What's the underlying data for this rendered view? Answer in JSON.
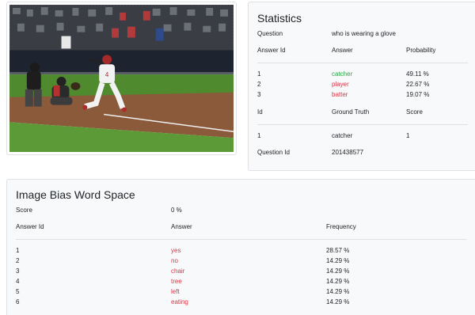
{
  "statistics": {
    "title": "Statistics",
    "question_label": "Question",
    "question_value": "who is wearing a glove",
    "headers": {
      "answer_id": "Answer Id",
      "answer": "Answer",
      "probability": "Probability"
    },
    "answers": [
      {
        "id": "1",
        "answer": "catcher",
        "probability": "49.11 %",
        "color": "#28a745"
      },
      {
        "id": "2",
        "answer": "player",
        "probability": "22.67 %",
        "color": "#dc3545"
      },
      {
        "id": "3",
        "answer": "batter",
        "probability": "19.07 %",
        "color": "#dc3545"
      }
    ],
    "gt_headers": {
      "id": "Id",
      "ground_truth": "Ground Truth",
      "score": "Score"
    },
    "ground_truth": [
      {
        "id": "1",
        "answer": "catcher",
        "score": "1"
      }
    ],
    "question_id_label": "Question Id",
    "question_id_value": "201438577"
  },
  "bias": {
    "title": "Image Bias Word Space",
    "score_label": "Score",
    "score_value": "0 %",
    "headers": {
      "answer_id": "Answer Id",
      "answer": "Answer",
      "frequency": "Frequency"
    },
    "rows": [
      {
        "id": "1",
        "answer": "yes",
        "frequency": "28.57 %"
      },
      {
        "id": "2",
        "answer": "no",
        "frequency": "14.29 %"
      },
      {
        "id": "3",
        "answer": "chair",
        "frequency": "14.29 %"
      },
      {
        "id": "4",
        "answer": "tree",
        "frequency": "14.29 %"
      },
      {
        "id": "5",
        "answer": "left",
        "frequency": "14.29 %"
      },
      {
        "id": "6",
        "answer": "eating",
        "frequency": "14.29 %"
      }
    ],
    "answer_color": "#dc3545"
  },
  "photo": {
    "icon": "baseball-scene-photo",
    "jersey_number": "4"
  }
}
